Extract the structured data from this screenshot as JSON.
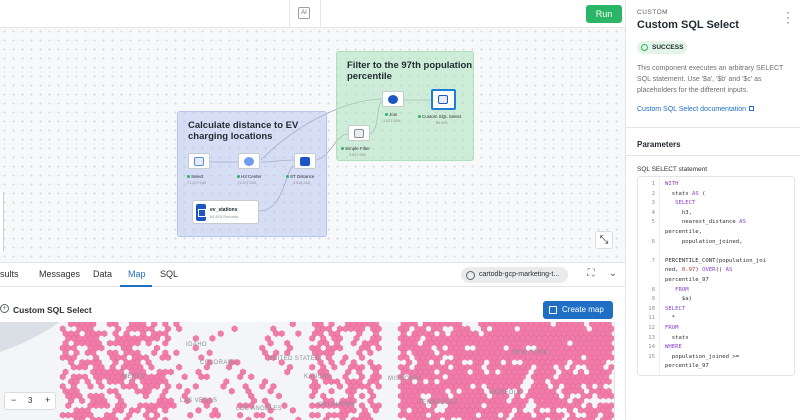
{
  "app": {
    "run_label": "Run",
    "ai_icon_text": "AI"
  },
  "canvas": {
    "groups": [
      {
        "title_line1": "Calculate distance to EV",
        "title_line2": "charging locations"
      },
      {
        "title_line1": "Filter to the 97th population",
        "title_line2": "percentile"
      }
    ],
    "nodes": [
      {
        "label": "Select",
        "count": "71.207.040"
      },
      {
        "label": "H3 Center",
        "count": "71.207.040"
      },
      {
        "label": "ST Distance",
        "count": "3.918.440"
      },
      {
        "label": "Simple Filter",
        "count": "3.897.950"
      },
      {
        "label": "Join",
        "count": "1.627.659"
      },
      {
        "label": "Custom SQL Select",
        "count": "66.903"
      }
    ],
    "source": {
      "name": "ev_stations",
      "desc": "64.815 Records"
    },
    "expand_icon": "expand-icon"
  },
  "tabs": {
    "items": [
      "sults",
      "Messages",
      "Data",
      "Map",
      "SQL"
    ],
    "active": "Map",
    "connection": "cartodb-gcp-marketing-t..."
  },
  "map_panel": {
    "title": "Custom SQL Select",
    "create_map": "Create map",
    "zoom_minus": "−",
    "zoom_value": "3",
    "zoom_plus": "+",
    "labels": [
      "UNITED STATES",
      "COLORADO",
      "KANSAS",
      "MISSOURI",
      "NEW YORK",
      "MENTO",
      "NORFOLK",
      "OKLAHOMA",
      "LAS VEGAS",
      "LOS ANGELES",
      "TENNESSEE",
      "IDAHO"
    ],
    "hex_color": "#f07ca8"
  },
  "panel": {
    "kicker": "CUSTOM",
    "title": "Custom SQL Select",
    "status": "SUCCESS",
    "description": "This component executes an arbitrary SELECT SQL statement. Use '$a', '$b' and '$c' as placeholders for the different inputs.",
    "doc_link": "Custom SQL Select documentation",
    "params_heading": "Parameters",
    "sql_label": "SQL SELECT statement",
    "sql_lines": [
      {
        "n": "1",
        "text": "WITH"
      },
      {
        "n": "2",
        "text": "  stats AS ("
      },
      {
        "n": "3",
        "text": "   SELECT"
      },
      {
        "n": "4",
        "text": "     h3,"
      },
      {
        "n": "5",
        "text": "     nearest_distance AS"
      },
      {
        "n": "",
        "text": "percentile,"
      },
      {
        "n": "6",
        "text": "     population_joined,"
      },
      {
        "n": "",
        "text": ""
      },
      {
        "n": "7",
        "text": "PERCENTILE_CONT(population_joi"
      },
      {
        "n": "",
        "text": "ned, 0.97) OVER() AS"
      },
      {
        "n": "",
        "text": "percentile_97"
      },
      {
        "n": "8",
        "text": "   FROM"
      },
      {
        "n": "9",
        "text": "     $a)"
      },
      {
        "n": "10",
        "text": "SELECT"
      },
      {
        "n": "11",
        "text": "  *"
      },
      {
        "n": "12",
        "text": "FROM"
      },
      {
        "n": "13",
        "text": "  stats"
      },
      {
        "n": "14",
        "text": "WHERE"
      },
      {
        "n": "15",
        "text": "  population_joined >="
      },
      {
        "n": "",
        "text": "percentile_97"
      }
    ]
  }
}
